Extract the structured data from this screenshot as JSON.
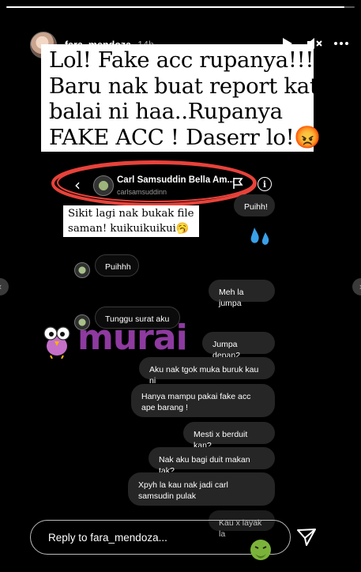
{
  "story": {
    "progress": 0.97,
    "username": "fara_mendoza",
    "time": "14h"
  },
  "caption": {
    "lines": [
      "Lol! Fake acc rupanya!!!",
      "Baru nak buat report kat",
      "balai ni haa..Rupanya",
      "FAKE ACC ! Daserr lo!😡"
    ]
  },
  "dm": {
    "name": "Carl Samsuddin Bella Am...",
    "handle": "carlsamsuddinn"
  },
  "note": {
    "lines": [
      "Sikit lagi nak bukak file",
      "saman! kuikuikuikui🥱"
    ]
  },
  "messages": [
    {
      "text": "Puihh!",
      "from": "me"
    },
    {
      "text": "Puihhh",
      "from": "them"
    },
    {
      "text": "Meh la jumpa",
      "from": "me"
    },
    {
      "text": "Tunggu surat aku",
      "from": "them"
    },
    {
      "text": "Jumpa depan2",
      "from": "me"
    },
    {
      "text": "Aku nak tgok muka buruk kau ni",
      "from": "me"
    },
    {
      "text": "Hanya mampu pakai fake acc ape barang !",
      "from": "me"
    },
    {
      "text": "Mesti x berduit kan?",
      "from": "me"
    },
    {
      "text": "Nak aku bagi duit makan tak?",
      "from": "me"
    },
    {
      "text": "Xpyh la kau nak jadi carl samsudin pulak",
      "from": "me"
    },
    {
      "text": "Kau x layak la",
      "from": "me"
    }
  ],
  "watermark": {
    "text": "murai"
  },
  "reply": {
    "placeholder": "Reply to fara_mendoza..."
  },
  "icons": {
    "play": "play-icon",
    "mute": "mute-icon",
    "more": "more-icon",
    "send": "send-icon",
    "back": "chevron-left-icon",
    "flag": "flag-icon",
    "info": "info-icon"
  },
  "colors": {
    "accent_red": "#e8423a",
    "brand_purple": "#8e3aa0"
  }
}
